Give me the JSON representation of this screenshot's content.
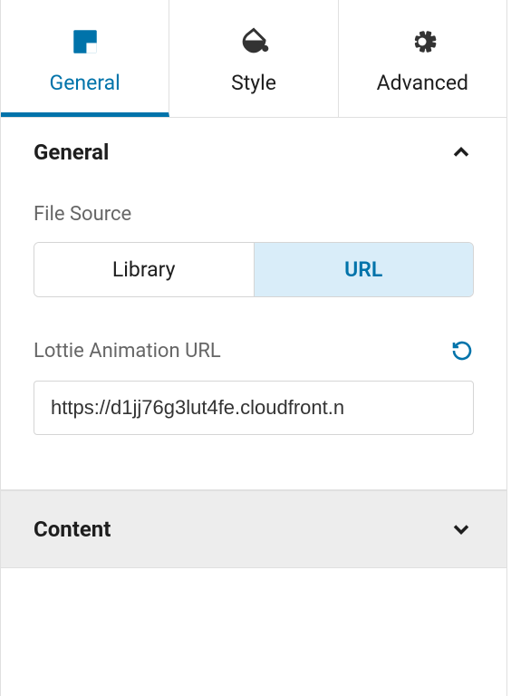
{
  "tabs": {
    "general": {
      "label": "General",
      "active": true
    },
    "style": {
      "label": "Style",
      "active": false
    },
    "advanced": {
      "label": "Advanced",
      "active": false
    }
  },
  "sections": {
    "general": {
      "title": "General",
      "expanded": true,
      "fileSource": {
        "label": "File Source",
        "options": {
          "library": "Library",
          "url": "URL"
        },
        "selected": "url"
      },
      "lottieUrl": {
        "label": "Lottie Animation URL",
        "value": "https://d1jj76g3lut4fe.cloudfront.n"
      }
    },
    "content": {
      "title": "Content",
      "expanded": false
    }
  },
  "colors": {
    "accent": "#0073aa",
    "segmentActiveBg": "#d9edf9"
  }
}
